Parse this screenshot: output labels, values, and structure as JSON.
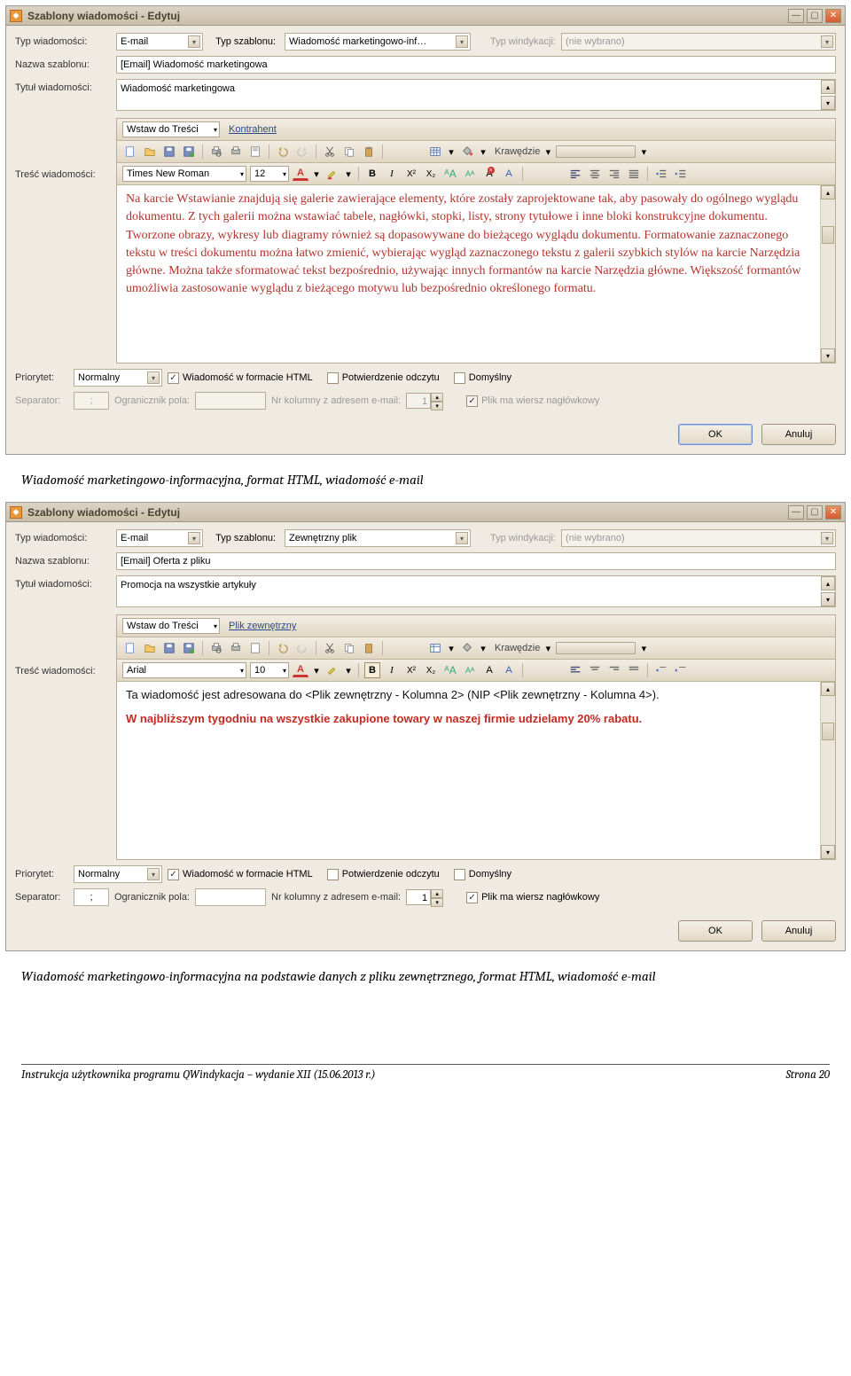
{
  "windows": [
    {
      "title": "Szablony wiadomości - Edytuj",
      "row1": {
        "msgtype_label": "Typ wiadomości:",
        "msgtype_value": "E-mail",
        "tpltype_label": "Typ szablonu:",
        "tpltype_value": "Wiadomość marketingowo-inf…",
        "windykacja_label": "Typ windykacji:",
        "windykacja_value": "(nie wybrano)"
      },
      "row2": {
        "label": "Nazwa szablonu:",
        "value": "[Email] Wiadomość marketingowa"
      },
      "row3": {
        "label": "Tytuł wiadomości:",
        "value": "Wiadomość marketingowa"
      },
      "tresc_label": "Treść wiadomości:",
      "insert_label": "Wstaw do Treści",
      "insert_link": "Kontrahent",
      "font_name": "Times New Roman",
      "font_size": "12",
      "krawedzie": "Krawędzie",
      "body_html": "Na karcie Wstawianie znajdują się galerie zawierające elementy, które zostały zaprojektowane tak, aby pasowały do ogólnego wyglądu dokumentu. Z tych galerii można wstawiać tabele, nagłówki, stopki, listy, strony tytułowe i inne bloki konstrukcyjne dokumentu. Tworzone obrazy, wykresy lub diagramy również są dopasowywane do bieżącego wyglądu dokumentu. Formatowanie zaznaczonego tekstu w treści dokumentu można łatwo zmienić, wybierając wygląd zaznaczonego tekstu z galerii szybkich stylów na karcie Narzędzia główne. Można także sformatować tekst bezpośrednio, używając innych formantów na karcie Narzędzia główne. Większość formantów umożliwia zastosowanie wyglądu z bieżącego motywu lub bezpośrednio określonego formatu.",
      "priority_row": {
        "label": "Priorytet:",
        "value": "Normalny",
        "chk_html": "Wiadomość w formacie HTML",
        "chk_confirm": "Potwierdzenie odczytu",
        "chk_default": "Domyślny"
      },
      "sep_row": {
        "sep_label": "Separator:",
        "sep_value": ";",
        "ogr_label": "Ogranicznik pola:",
        "ogr_value": "",
        "kol_label": "Nr kolumny z adresem e-mail:",
        "kol_value": "1",
        "hdr_label": "Plik ma wiersz nagłówkowy",
        "disabled": true
      },
      "ok": "OK",
      "cancel": "Anuluj"
    },
    {
      "title": "Szablony wiadomości - Edytuj",
      "row1": {
        "msgtype_label": "Typ wiadomości:",
        "msgtype_value": "E-mail",
        "tpltype_label": "Typ szablonu:",
        "tpltype_value": "Zewnętrzny plik",
        "windykacja_label": "Typ windykacji:",
        "windykacja_value": "(nie wybrano)"
      },
      "row2": {
        "label": "Nazwa szablonu:",
        "value": "[Email] Oferta z pliku"
      },
      "row3": {
        "label": "Tytuł wiadomości:",
        "value": "Promocja na wszystkie artykuły"
      },
      "tresc_label": "Treść wiadomości:",
      "insert_label": "Wstaw do Treści",
      "insert_link": "Plik zewnętrzny",
      "font_name": "Arial",
      "font_size": "10",
      "krawedzie": "Krawędzie",
      "body_line1": "Ta wiadomość jest adresowana do <Plik zewnętrzny - Kolumna 2> (NIP <Plik zewnętrzny - Kolumna 4>).",
      "body_line2": "W najbliższym tygodniu na wszystkie zakupione towary w naszej firmie udzielamy 20% rabatu.",
      "priority_row": {
        "label": "Priorytet:",
        "value": "Normalny",
        "chk_html": "Wiadomość w formacie HTML",
        "chk_confirm": "Potwierdzenie odczytu",
        "chk_default": "Domyślny"
      },
      "sep_row": {
        "sep_label": "Separator:",
        "sep_value": ";",
        "ogr_label": "Ogranicznik pola:",
        "ogr_value": "",
        "kol_label": "Nr kolumny z adresem e-mail:",
        "kol_value": "1",
        "hdr_label": "Plik ma wiersz nagłówkowy",
        "disabled": false
      },
      "ok": "OK",
      "cancel": "Anuluj"
    }
  ],
  "caption1": "Wiadomość marketingowo-informacyjna, format HTML, wiadomość e-mail",
  "caption2": "Wiadomość marketingowo-informacyjna na podstawie danych z pliku zewnętrznego, format HTML, wiadomość e-mail",
  "footer_left": "Instrukcja użytkownika programu QWindykacja – wydanie XII (15.06.2013 r.)",
  "footer_right": "Strona 20"
}
